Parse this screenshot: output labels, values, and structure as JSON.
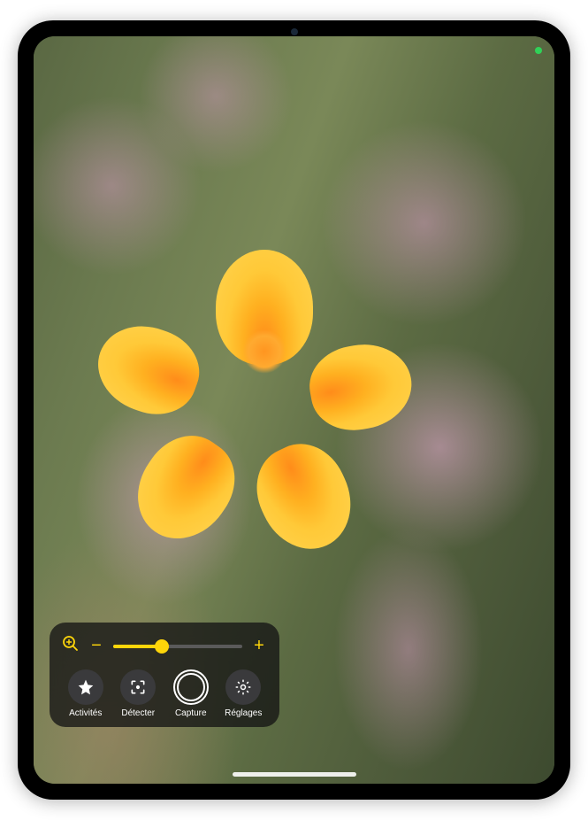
{
  "status": {
    "camera_active_color": "#30d158"
  },
  "zoom": {
    "minus_label": "−",
    "plus_label": "+",
    "value_percent": 38,
    "accent_color": "#ffd60a"
  },
  "controls": {
    "activities": {
      "label": "Activités"
    },
    "detect": {
      "label": "Détecter"
    },
    "capture": {
      "label": "Capture"
    },
    "settings": {
      "label": "Réglages"
    }
  }
}
